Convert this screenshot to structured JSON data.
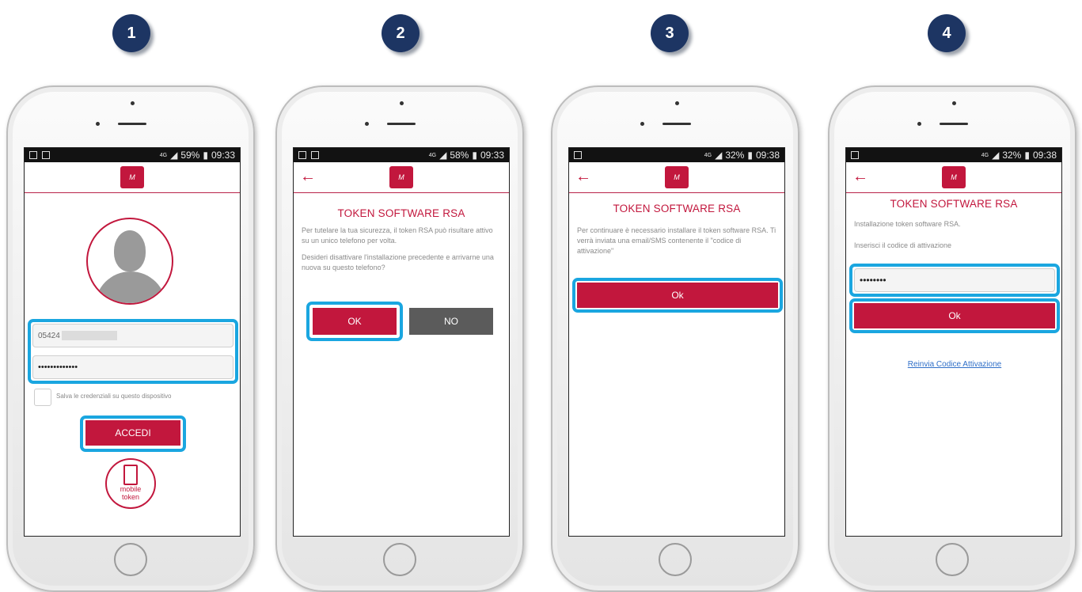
{
  "steps": [
    "1",
    "2",
    "3",
    "4"
  ],
  "colors": {
    "brand_red": "#c2173d",
    "highlight": "#1aa6e0",
    "badge": "#1d3563"
  },
  "screen1": {
    "status_left_icons": [
      "image-icon",
      "mail-icon"
    ],
    "network": "4G",
    "battery": "59%",
    "time": "09:33",
    "username_value": "05424",
    "password_value": "•••••••••••••",
    "remember_label": "Salva le credenziali su questo dispositivo",
    "login_button": "ACCEDI",
    "mobile_token_label_line1": "mobile",
    "mobile_token_label_line2": "token"
  },
  "screen2": {
    "network": "4G",
    "battery": "58%",
    "time": "09:33",
    "title": "TOKEN SOFTWARE RSA",
    "paragraph1": "Per tutelare la tua sicurezza, il token RSA può risultare attivo su un unico telefono per volta.",
    "paragraph2": "Desideri disattivare l'installazione precedente e arrivarne una nuova su questo telefono?",
    "ok_button": "OK",
    "no_button": "NO"
  },
  "screen3": {
    "network": "4G",
    "battery": "32%",
    "time": "09:38",
    "title": "TOKEN SOFTWARE RSA",
    "paragraph": "Per continuare è necessario installare il token software RSA. Ti verrà inviata una email/SMS contenente il \"codice di attivazione\"",
    "ok_button": "Ok"
  },
  "screen4": {
    "network": "4G",
    "battery": "32%",
    "time": "09:38",
    "title": "TOKEN SOFTWARE RSA",
    "line1": "Installazione token software RSA.",
    "code_label": "Inserisci il codice di attivazione",
    "code_value": "••••••••",
    "ok_button": "Ok",
    "resend_link": "Reinvia Codice Attivazione"
  }
}
